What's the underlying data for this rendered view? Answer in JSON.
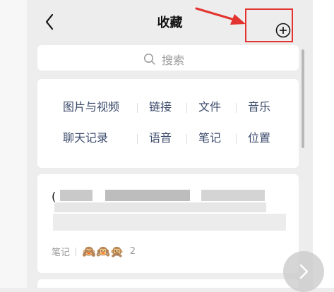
{
  "header": {
    "title": "收藏"
  },
  "search": {
    "placeholder": "搜索"
  },
  "filters": {
    "row1": [
      "图片与视频",
      "链接",
      "文件",
      "音乐"
    ],
    "row2": [
      "聊天记录",
      "语音",
      "笔记",
      "位置"
    ]
  },
  "card": {
    "first_char": "(",
    "type_label": "笔记",
    "emojis": "🙈🙉🙊",
    "count": "2"
  },
  "colors": {
    "highlight": "#e3342f",
    "filter_text": "#3b4a6b",
    "background": "#ededed"
  },
  "icons": {
    "back": "chevron-left-icon",
    "add": "plus-circle-icon",
    "search": "search-icon",
    "next": "chevron-right-icon"
  }
}
